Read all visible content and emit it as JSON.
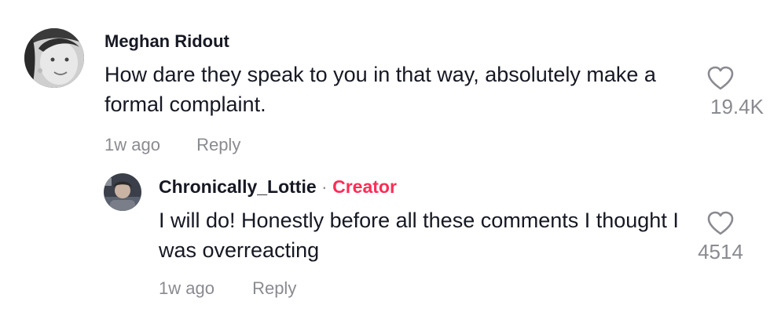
{
  "comments": [
    {
      "username": "Meghan Ridout",
      "text": "How dare they speak to you in that way, absolutely make a formal complaint.",
      "time": "1w ago",
      "reply_label": "Reply",
      "likes": "19.4K",
      "avatar_icon": "user-avatar-photo"
    }
  ],
  "replies": [
    {
      "username": "Chronically_Lottie",
      "separator": " · ",
      "badge": "Creator",
      "text": "I will do! Honestly before all these comments I thought I was overreacting",
      "time": "1w ago",
      "reply_label": "Reply",
      "likes": "4514",
      "avatar_icon": "user-avatar-photo"
    }
  ],
  "colors": {
    "text": "#161823",
    "muted": "#8a8b91",
    "creator": "#fe2c55"
  }
}
